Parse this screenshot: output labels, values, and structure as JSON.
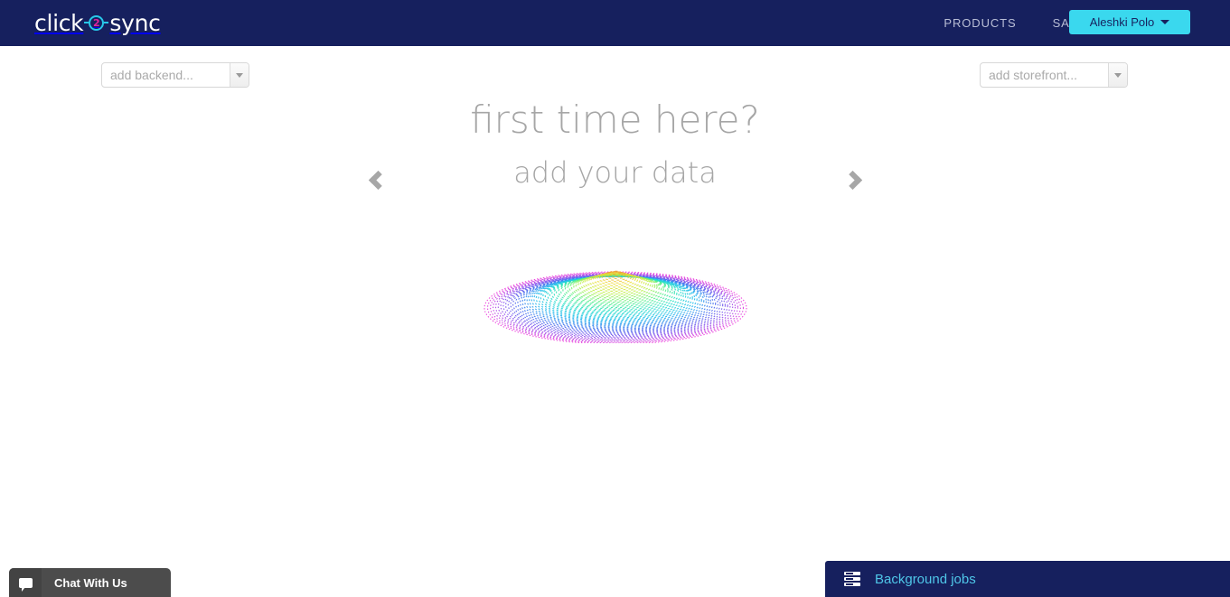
{
  "navbar": {
    "brand": {
      "first": "click",
      "badge": "2",
      "second": "sync",
      "circle_color": "#28c8e8",
      "badge_color": "#e3219e"
    },
    "links": [
      {
        "label": "PRODUCTS",
        "name": "nav-link-products"
      },
      {
        "label": "SALES",
        "name": "nav-link-sales"
      }
    ],
    "user_button": {
      "label": "Aleshki Polo",
      "icon": "chevron-down-icon",
      "bg_color": "#3ad8ee",
      "text_color": "#17225f"
    },
    "bg_color": "#16205e"
  },
  "selects": {
    "backend": {
      "placeholder": "add backend...",
      "arrow_icon": "caret-down-icon"
    },
    "storefront": {
      "placeholder": "add storefront...",
      "arrow_icon": "caret-down-icon"
    }
  },
  "hero": {
    "title": "first time here?",
    "subtitle": "add your data",
    "prev_icon": "chevron-left-icon",
    "next_icon": "chevron-right-icon",
    "text_color": "#a6a6a6"
  },
  "spinner": {
    "name": "loading-spinner",
    "description": "concentric rainbow ellipses cone",
    "colors": [
      "#ee44dd",
      "#8855ee",
      "#4477ee",
      "#22bbee",
      "#22ddcc",
      "#55ee88",
      "#bbee44",
      "#eedd33",
      "#ee9933"
    ]
  },
  "chat_widget": {
    "label": "Chat With Us",
    "icon": "chat-bubble-icon",
    "bg_color": "#4c4c4c"
  },
  "background_jobs": {
    "label": "Background jobs",
    "icon": "server-stack-icon",
    "bg_color": "#16205e",
    "text_color": "#4fc6e8"
  }
}
